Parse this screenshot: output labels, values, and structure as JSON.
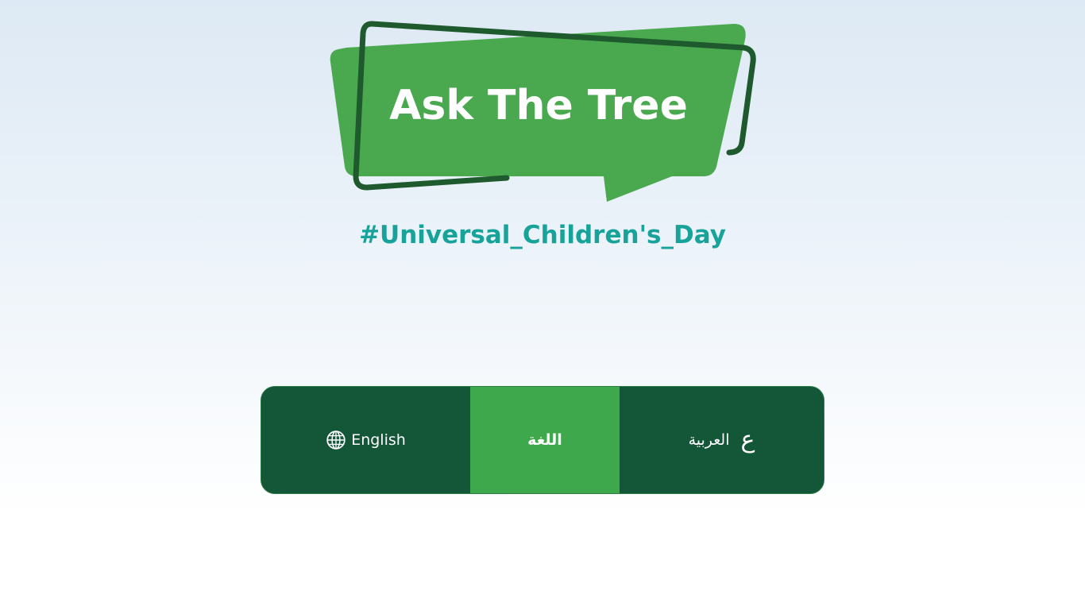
{
  "logo": {
    "title": "Ask The Tree",
    "colors": {
      "bubble": "#4aa84f",
      "frame": "#1e5a2e"
    }
  },
  "hashtag": "#Universal_Children's_Day",
  "language_selector": {
    "english_label": "English",
    "english_icon": "globe-icon",
    "center_label": "اللغة",
    "arabic_label": "العربية",
    "arabic_icon": "ع"
  },
  "colors": {
    "dark_green": "#135638",
    "accent_green": "#3ea84c",
    "hashtag_teal": "#17a39a"
  }
}
